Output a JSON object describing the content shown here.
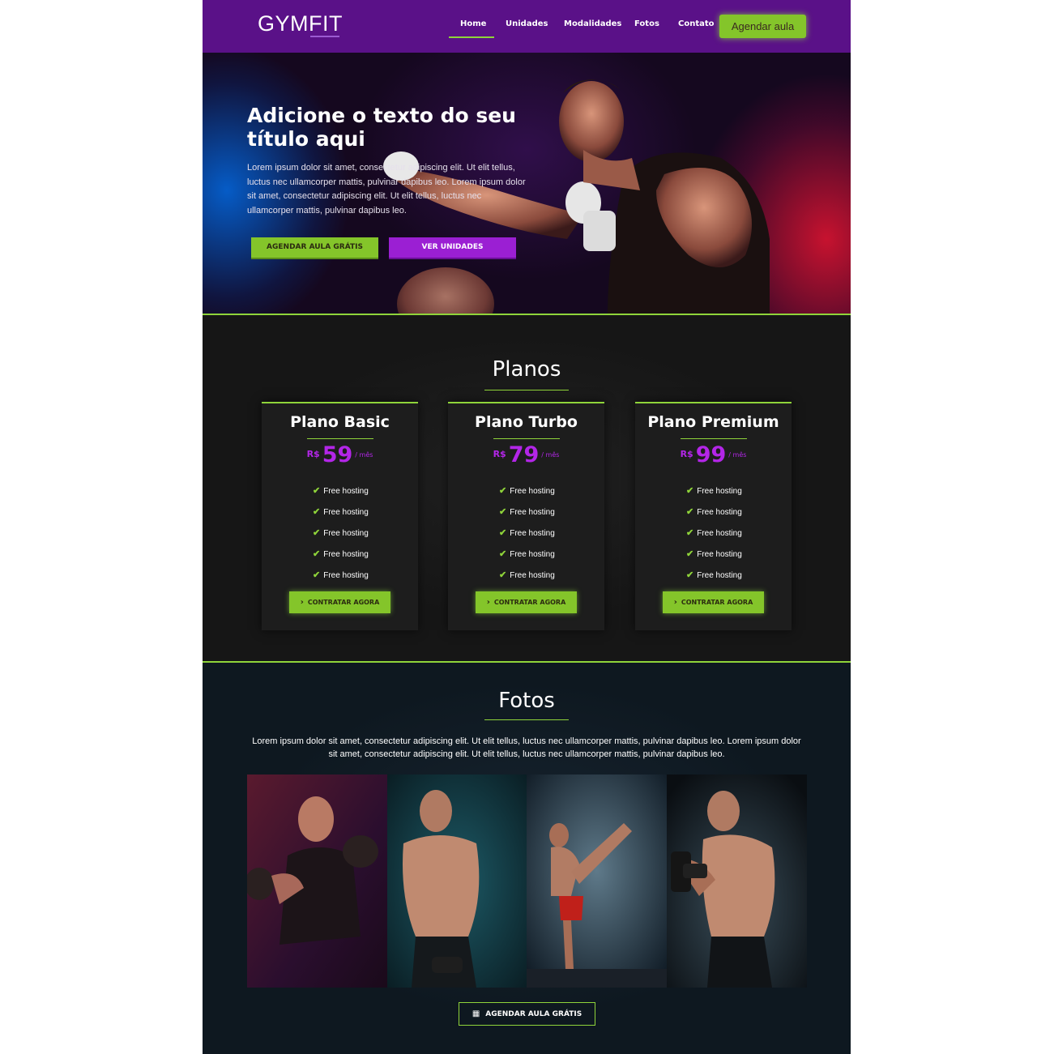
{
  "header": {
    "logo": "GYMFIT",
    "nav": [
      "Home",
      "Unidades",
      "Modalidades",
      "Fotos",
      "Contato"
    ],
    "active_nav": "Home",
    "cta": "Agendar aula"
  },
  "hero": {
    "title": "Adicione o texto do seu título aqui",
    "text": "Lorem ipsum dolor sit amet, consectetur adipiscing elit. Ut elit tellus, luctus nec ullamcorper mattis, pulvinar dapibus leo. Lorem ipsum dolor sit amet, consectetur adipiscing elit. Ut elit tellus, luctus nec ullamcorper mattis, pulvinar dapibus leo.",
    "btn_primary": "AGENDAR AULA GRÁTIS",
    "btn_secondary": "VER UNIDADES"
  },
  "plans": {
    "title": "Planos",
    "items": [
      {
        "name": "Plano Basic",
        "currency": "R$",
        "price": "59",
        "period": "/ mês",
        "features": [
          "Free hosting",
          "Free hosting",
          "Free hosting",
          "Free hosting",
          "Free hosting"
        ],
        "button": "CONTRATAR AGORA"
      },
      {
        "name": "Plano Turbo",
        "currency": "R$",
        "price": "79",
        "period": "/ mês",
        "features": [
          "Free hosting",
          "Free hosting",
          "Free hosting",
          "Free hosting",
          "Free hosting"
        ],
        "button": "CONTRATAR AGORA"
      },
      {
        "name": "Plano Premium",
        "currency": "R$",
        "price": "99",
        "period": "/ mês",
        "features": [
          "Free hosting",
          "Free hosting",
          "Free hosting",
          "Free hosting",
          "Free hosting"
        ],
        "button": "CONTRATAR AGORA"
      }
    ]
  },
  "fotos": {
    "title": "Fotos",
    "text": "Lorem ipsum dolor sit amet, consectetur adipiscing elit. Ut elit tellus, luctus nec ullamcorper mattis, pulvinar dapibus leo. Lorem ipsum dolor sit amet, consectetur adipiscing elit. Ut elit tellus, luctus nec ullamcorper mattis, pulvinar dapibus leo.",
    "button": "AGENDAR AULA GRÁTIS"
  },
  "colors": {
    "header_bg": "#5a1188",
    "accent_green": "#84c52a",
    "accent_purple": "#9b1fd3",
    "price_purple": "#b326e8"
  },
  "icons": [
    "check-icon",
    "chevron-right-icon",
    "calendar-icon"
  ]
}
